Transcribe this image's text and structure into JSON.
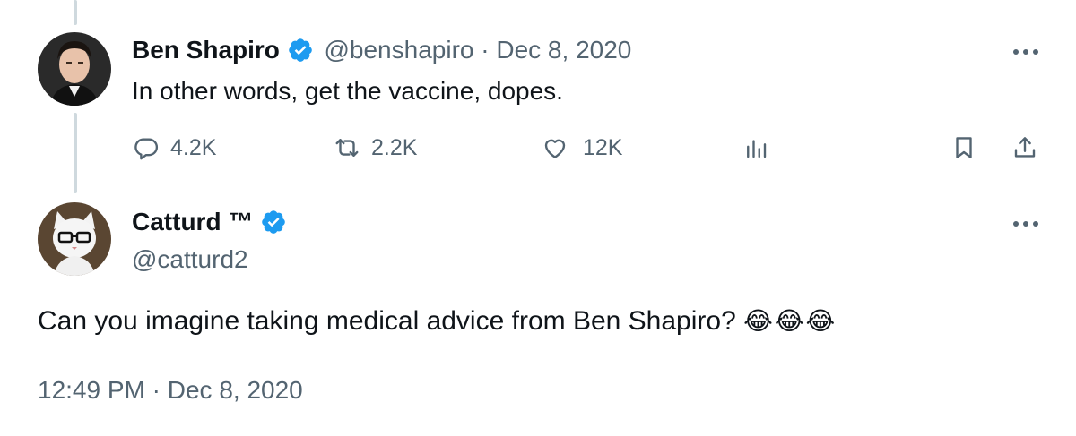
{
  "reply_tweet": {
    "author_name": "Ben Shapiro",
    "handle": "@benshapiro",
    "separator": "·",
    "date": "Dec 8, 2020",
    "text": "In other words, get the vaccine, dopes.",
    "actions": {
      "replies": "4.2K",
      "retweets": "2.2K",
      "likes": "12K"
    }
  },
  "main_tweet": {
    "author_name": "Catturd ™",
    "handle": "@catturd2",
    "text": "Can you imagine taking medical advice from Ben Shapiro?",
    "emoji": "😂😂😂",
    "time": "12:49 PM",
    "separator": "·",
    "date": "Dec 8, 2020"
  },
  "colors": {
    "verified": "#1d9bf0",
    "muted": "#536471",
    "thread_line": "#cfd9de"
  },
  "icons": [
    "verified-badge-icon",
    "more-icon",
    "reply-icon",
    "retweet-icon",
    "like-icon",
    "analytics-icon",
    "bookmark-icon",
    "share-icon"
  ]
}
